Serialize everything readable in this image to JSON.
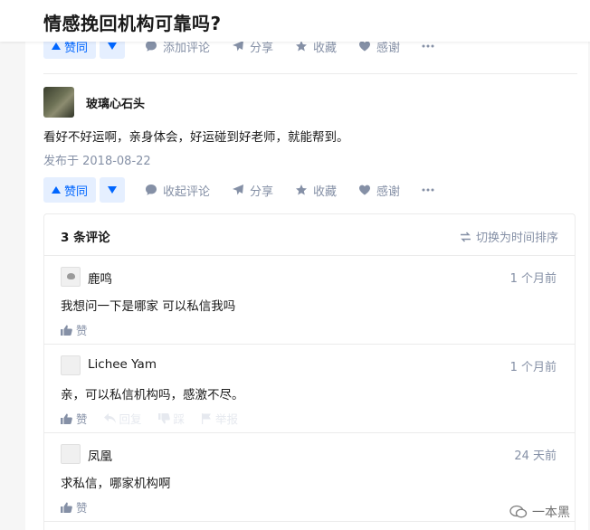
{
  "question": {
    "title": "情感挽回机构可靠吗?"
  },
  "colors": {
    "primary": "#0066ff",
    "vote_bg": "#e5efff",
    "muted": "#8590a6"
  },
  "top_actions": {
    "vote_up_label": "赞同",
    "comment_label": "添加评论",
    "share_label": "分享",
    "collect_label": "收藏",
    "thanks_label": "感谢",
    "more_icon": "ellipsis-icon"
  },
  "answer": {
    "author": "玻璃心石头",
    "content": "看好不好运啊，亲身体会，好运碰到好老师，就能帮到。",
    "published": "发布于 2018-08-22",
    "actions": {
      "vote_up_label": "赞同",
      "comment_label": "收起评论",
      "share_label": "分享",
      "collect_label": "收藏",
      "thanks_label": "感谢"
    }
  },
  "comments": {
    "count_label": "3 条评论",
    "sort_label": "切换为时间排序",
    "items": [
      {
        "name": "鹿鸣",
        "time": "1 个月前",
        "text": "我想问一下是哪家 可以私信我吗",
        "like_label": "赞"
      },
      {
        "name": "Lichee Yam",
        "time": "1 个月前",
        "text": "亲，可以私信机构吗，感激不尽。",
        "like_label": "赞",
        "reply_label": "回复",
        "dislike_label": "踩",
        "report_label": "举报"
      },
      {
        "name": "凤凰",
        "time": "24 天前",
        "text": "求私信，哪家机构啊",
        "like_label": "赞"
      }
    ]
  },
  "watermark": {
    "text": "一本黑"
  }
}
